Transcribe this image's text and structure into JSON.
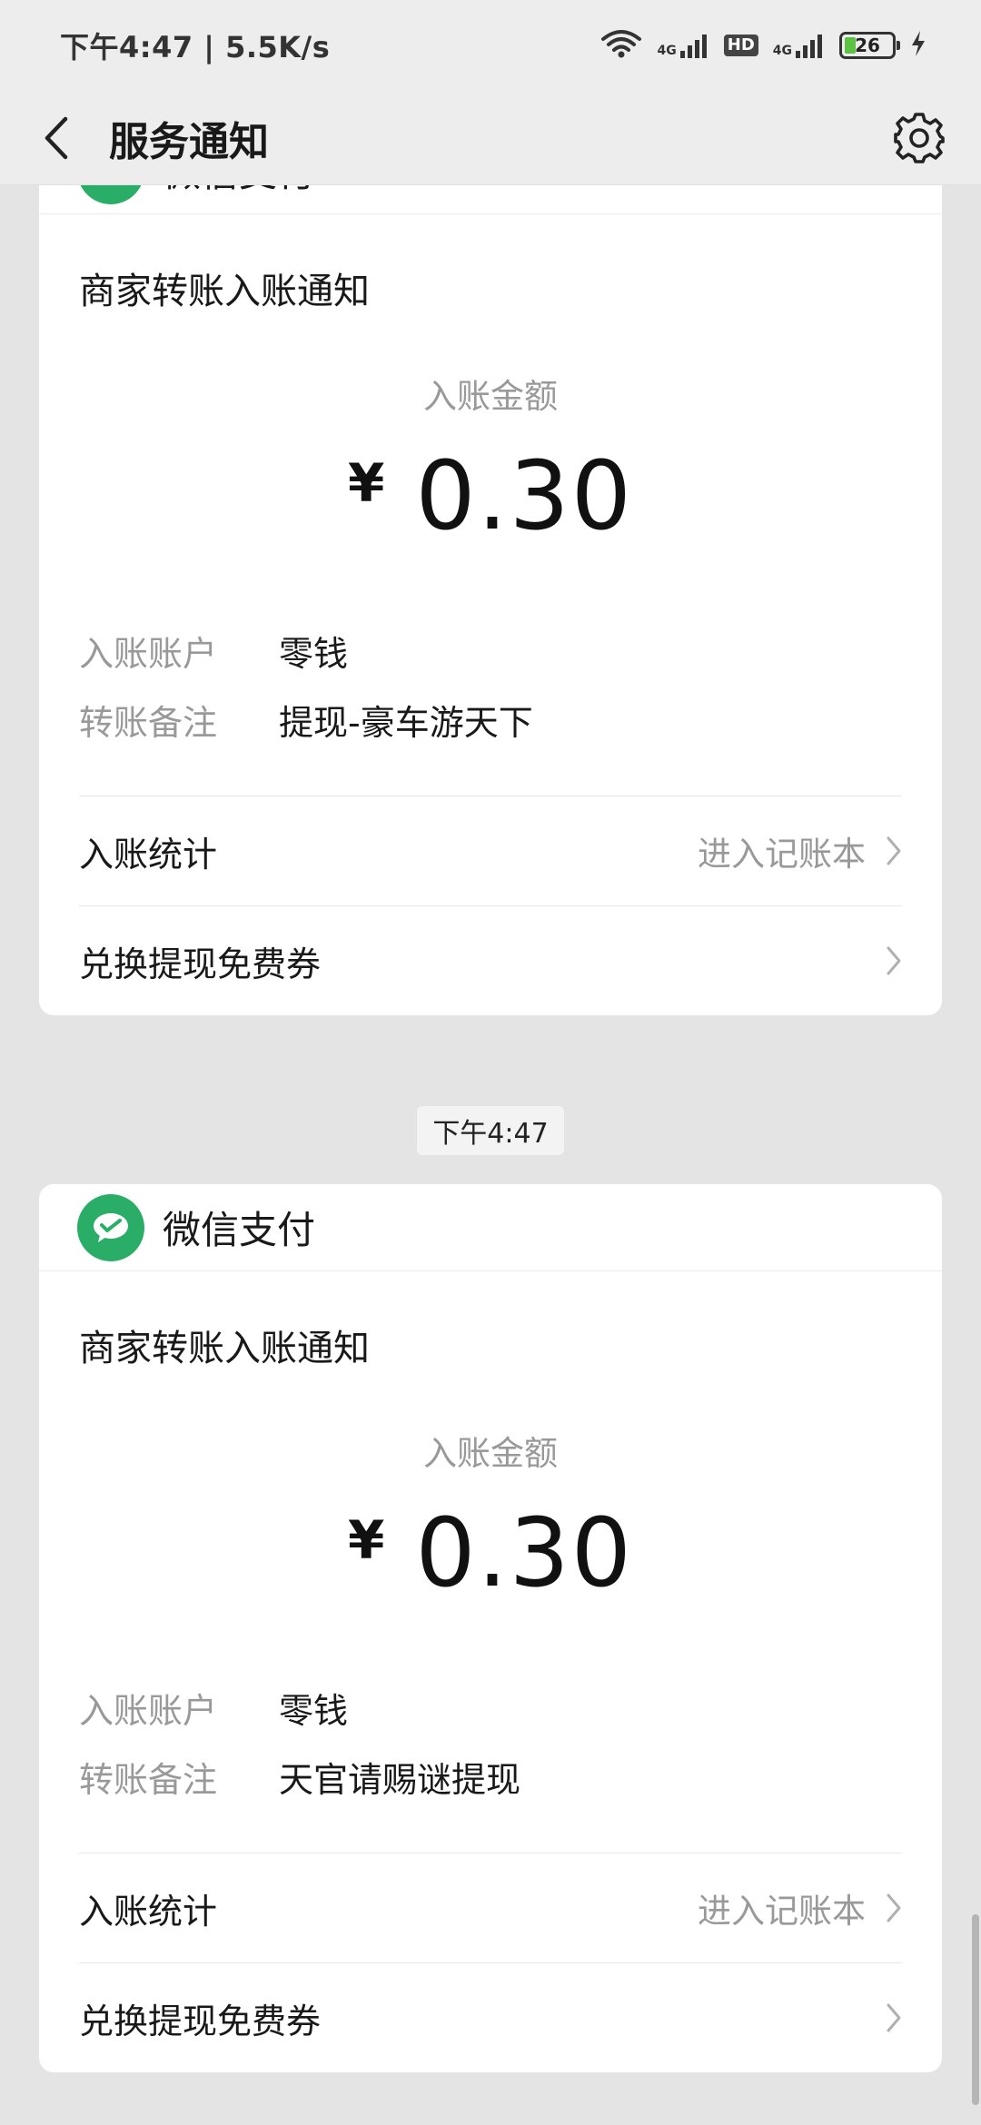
{
  "status_bar": {
    "time_speed": "下午4:47 | 5.5K/s",
    "net1": "4G",
    "hd": "HD",
    "net2": "4G",
    "battery": "26"
  },
  "nav": {
    "title": "服务通知"
  },
  "cards": [
    {
      "brand": "微信支付",
      "title": "商家转账入账通知",
      "amount_label": "入账金额",
      "currency": "¥",
      "amount": "0.30",
      "account_key": "入账账户",
      "account_value": "零钱",
      "note_key": "转账备注",
      "note_value": "提现-豪车游天下",
      "stats_label": "入账统计",
      "stats_hint": "进入记账本",
      "coupon_label": "兑换提现免费券"
    },
    {
      "brand": "微信支付",
      "title": "商家转账入账通知",
      "amount_label": "入账金额",
      "currency": "¥",
      "amount": "0.30",
      "account_key": "入账账户",
      "account_value": "零钱",
      "note_key": "转账备注",
      "note_value": "天官请赐谜提现",
      "stats_label": "入账统计",
      "stats_hint": "进入记账本",
      "coupon_label": "兑换提现免费券"
    }
  ],
  "time_chip": "下午4:47"
}
